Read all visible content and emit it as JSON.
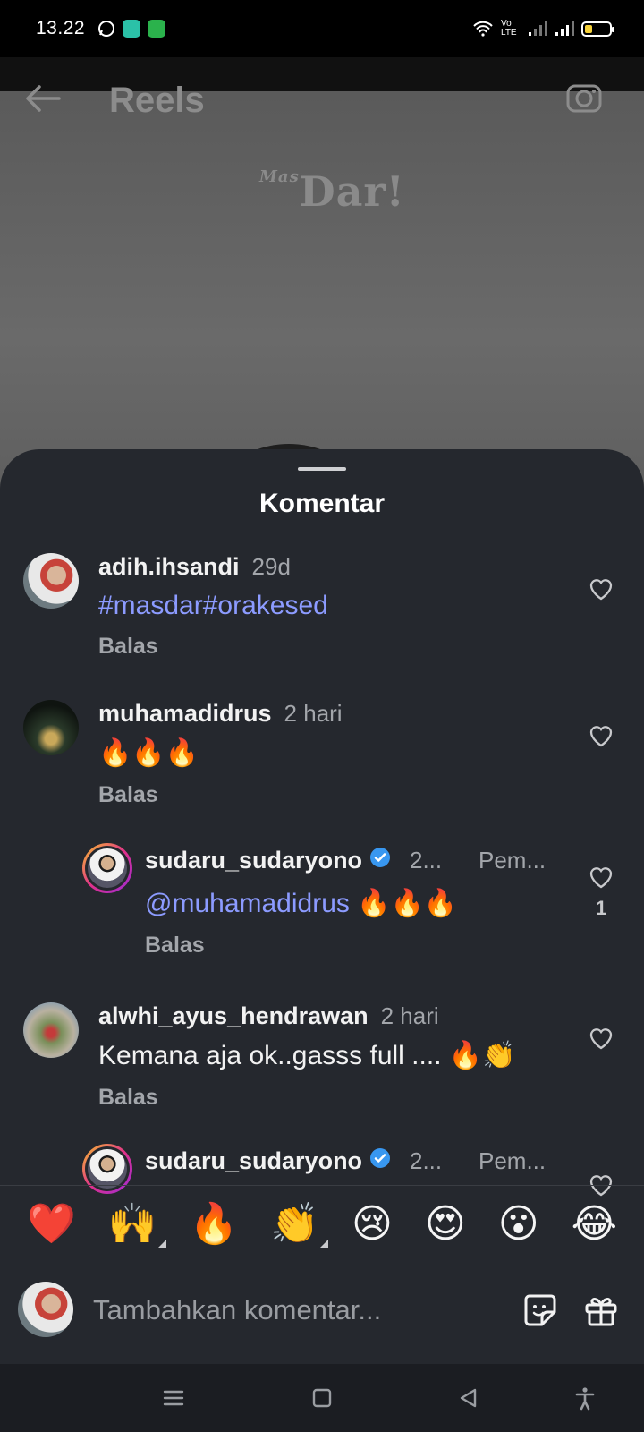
{
  "status_bar": {
    "time": "13.22",
    "network_label": "Vo LTE"
  },
  "reel": {
    "title": "Reels",
    "logo_small": "Mas",
    "logo_big": "Dar!"
  },
  "sheet": {
    "title": "Komentar"
  },
  "comments": [
    {
      "username": "adih.ihsandi",
      "time": "29d",
      "text_tag": "#masdar#orakesed",
      "reply_label": "Balas"
    },
    {
      "username": "muhamadidrus",
      "time": "2 hari",
      "text": "🔥🔥🔥",
      "reply_label": "Balas"
    },
    {
      "username": "sudaru_sudaryono",
      "time": "2...",
      "badge": "Pem...",
      "mention": "@muhamadidrus",
      "text": " 🔥🔥🔥",
      "reply_label": "Balas",
      "like_count": "1"
    },
    {
      "username": "alwhi_ayus_hendrawan",
      "time": "2 hari",
      "text": "Kemana aja ok..gasss full .... 🔥👏",
      "reply_label": "Balas"
    },
    {
      "username": "sudaru_sudaryono",
      "time": "2...",
      "badge": "Pem..."
    }
  ],
  "emoji_bar": [
    "❤️",
    "🙌",
    "🔥",
    "👏",
    "😢",
    "😍",
    "😮",
    "😂"
  ],
  "input": {
    "placeholder": "Tambahkan komentar..."
  },
  "colors": {
    "sheet_bg": "#25282e",
    "tag_color": "#8c9bff",
    "verified": "#3897f0"
  }
}
